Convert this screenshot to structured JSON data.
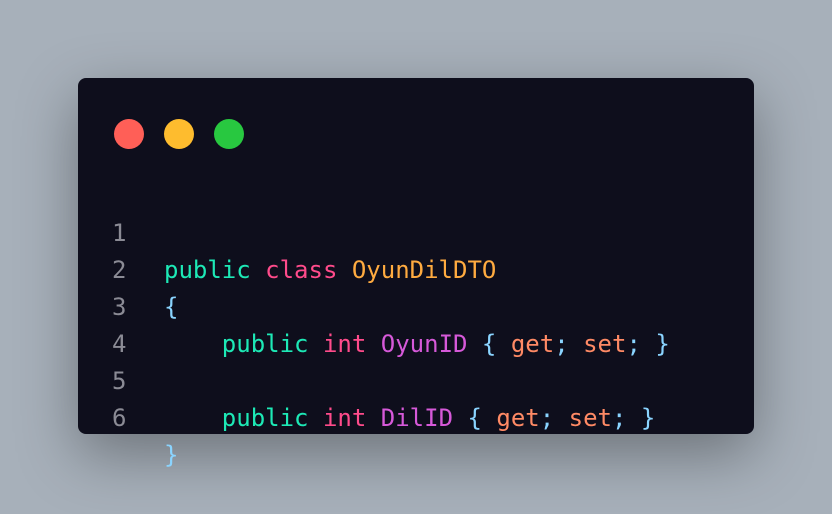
{
  "window": {
    "controls": [
      {
        "name": "close",
        "color": "#ff5f57"
      },
      {
        "name": "minimize",
        "color": "#febc2e"
      },
      {
        "name": "maximize",
        "color": "#28c840"
      }
    ]
  },
  "code": {
    "lines": [
      {
        "number": "1",
        "public": "public",
        "class": "class",
        "class_name": "OyunDilDTO"
      },
      {
        "number": "2",
        "brace": "{"
      },
      {
        "number": "3",
        "public": "public",
        "type": "int",
        "prop": "OyunID",
        "open": "{",
        "get": "get",
        "sep1": ";",
        "set": "set",
        "sep2": ";",
        "close": "}"
      },
      {
        "number": "4"
      },
      {
        "number": "5",
        "public": "public",
        "type": "int",
        "prop": "DilID",
        "open": "{",
        "get": "get",
        "sep1": ";",
        "set": "set",
        "sep2": ";",
        "close": "}"
      },
      {
        "number": "6",
        "brace": "}"
      }
    ]
  }
}
